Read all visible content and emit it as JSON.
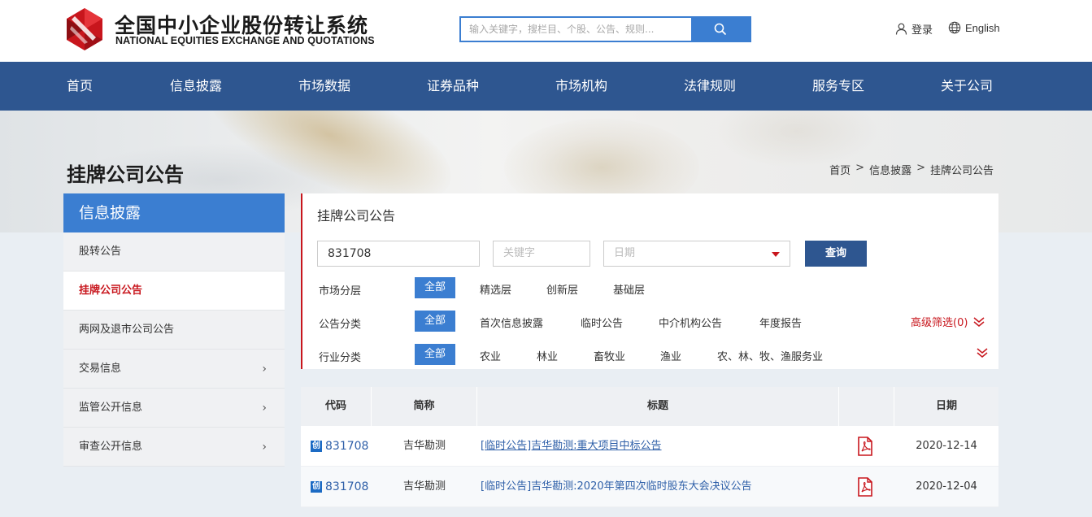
{
  "header": {
    "brand_cn": "全国中小企业股份转让系统",
    "brand_en": "NATIONAL EQUITIES EXCHANGE AND QUOTATIONS",
    "search_placeholder": "输入关键字，搜栏目、个股、公告、规则...",
    "login_label": "登录",
    "lang_label": "English"
  },
  "nav": [
    "首页",
    "信息披露",
    "市场数据",
    "证券品种",
    "市场机构",
    "法律规则",
    "服务专区",
    "关于公司"
  ],
  "banner": {
    "page_title": "挂牌公司公告",
    "breadcrumb": [
      "首页",
      "信息披露",
      "挂牌公司公告"
    ],
    "breadcrumb_sep": ">"
  },
  "sidebar": {
    "title": "信息披露",
    "items": [
      {
        "label": "股转公告"
      },
      {
        "label": "挂牌公司公告"
      },
      {
        "label": "两网及退市公司公告"
      },
      {
        "label": "交易信息"
      },
      {
        "label": "监管公开信息"
      },
      {
        "label": "审查公开信息"
      }
    ],
    "active_index": 1
  },
  "filter": {
    "title": "挂牌公司公告",
    "code_value": "831708",
    "keyword_placeholder": "关键字",
    "date_placeholder": "日期",
    "query_label": "查询",
    "market_label": "市场分层",
    "market_options": [
      "全部",
      "精选层",
      "创新层",
      "基础层"
    ],
    "notice_label": "公告分类",
    "notice_options": [
      "全部",
      "首次信息披露",
      "临时公告",
      "中介机构公告",
      "年度报告"
    ],
    "industry_label": "行业分类",
    "industry_options": [
      "全部",
      "农业",
      "林业",
      "畜牧业",
      "渔业",
      "农、林、牧、渔服务业"
    ],
    "advanced_label": "高级筛选(0)"
  },
  "table": {
    "headers": [
      "代码",
      "简称",
      "标题",
      "",
      "日期"
    ],
    "badge": "创",
    "rows": [
      {
        "code": "831708",
        "name": "吉华勘测",
        "title": "[临时公告]吉华勘测:重大项目中标公告",
        "date": "2020-12-14"
      },
      {
        "code": "831708",
        "name": "吉华勘测",
        "title": "[临时公告]吉华勘测:2020年第四次临时股东大会决议公告",
        "date": "2020-12-04"
      }
    ]
  },
  "colors": {
    "nav_blue": "#2e5690",
    "accent_blue": "#3b7ed1",
    "brand_red": "#c8161d"
  }
}
